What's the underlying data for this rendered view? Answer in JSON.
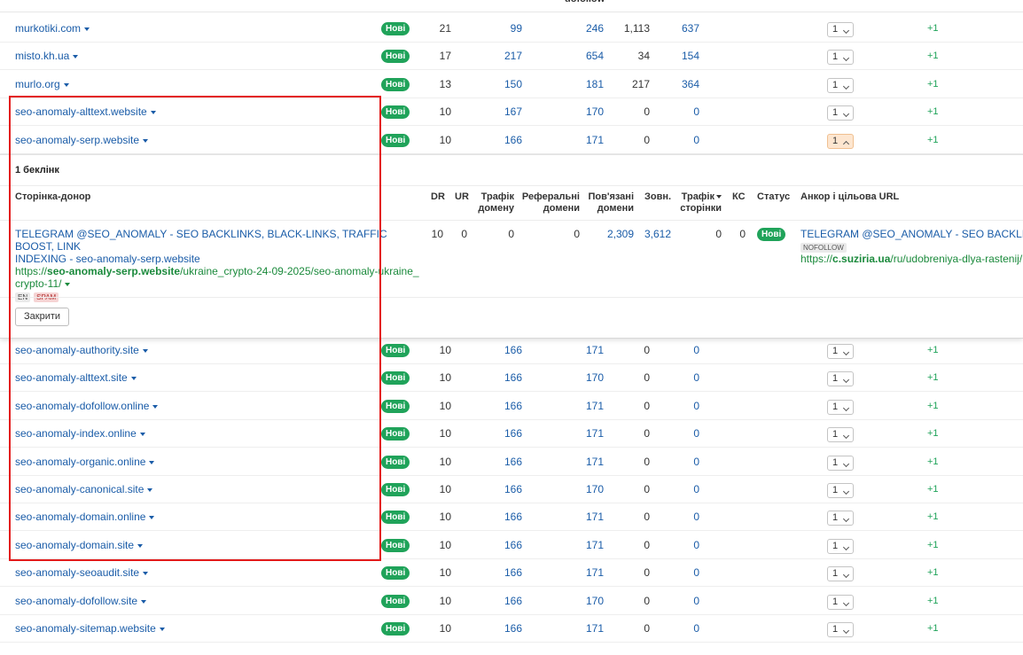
{
  "header_fragment": "dofollow",
  "badge_label": "Нові",
  "rows_top": [
    {
      "domain": "murkotiki.com",
      "dr": "21",
      "a": "99",
      "b": "246",
      "c": "1,113",
      "d": "637",
      "sel": "1",
      "delta": "+1"
    },
    {
      "domain": "misto.kh.ua",
      "dr": "17",
      "a": "217",
      "b": "654",
      "c": "34",
      "d": "154",
      "sel": "1",
      "delta": "+1"
    },
    {
      "domain": "murlo.org",
      "dr": "13",
      "a": "150",
      "b": "181",
      "c": "217",
      "d": "364",
      "sel": "1",
      "delta": "+1"
    },
    {
      "domain": "seo-anomaly-alttext.website",
      "dr": "10",
      "a": "167",
      "b": "170",
      "c": "0",
      "d": "0",
      "sel": "1",
      "delta": "+1"
    },
    {
      "domain": "seo-anomaly-serp.website",
      "dr": "10",
      "a": "166",
      "b": "171",
      "c": "0",
      "d": "0",
      "sel": "1",
      "delta": "+1"
    }
  ],
  "panel": {
    "title": "1 беклінк",
    "headers": {
      "donor": "Сторінка-донор",
      "dr": "DR",
      "ur": "UR",
      "domain_traffic_1": "Трафік",
      "domain_traffic_2": "домену",
      "ref_domains_1": "Реферальні",
      "ref_domains_2": "домени",
      "linked_domains_1": "Пов'язані",
      "linked_domains_2": "домени",
      "external": "Зовн.",
      "page_traffic_1": "Трафік",
      "page_traffic_2": "сторінки",
      "kw": "КС",
      "status": "Статус",
      "anchor": "Анкор і цільова URL"
    },
    "backlink": {
      "title_line1": "TELEGRAM @SEO_ANOMALY - SEO BACKLINKS, BLACK-LINKS, TRAFFIC BOOST, LINK",
      "title_line2": "INDEXING - seo-anomaly-serp.website",
      "url_prefix": "https://",
      "url_domain": "seo-anomaly-serp.website",
      "url_path1": "/ukraine_crypto-24-09-2025/seo-anomaly-ukraine_",
      "url_path2": "crypto-11/",
      "tag_lang": "EN",
      "tag_spam": "SPAM",
      "dr": "10",
      "ur": "0",
      "domain_traffic": "0",
      "ref_domains": "0",
      "linked_domains": "2,309",
      "external": "3,612",
      "page_traffic": "0",
      "kw": "0",
      "status": "Нові",
      "anchor_text": "TELEGRAM @SEO_ANOMALY - SEO BACKLINKS",
      "anchor_tag": "NOFOLLOW",
      "target_prefix": "https://",
      "target_domain": "c.suziria.ua",
      "target_path": "/ru/udobreniya-dlya-rastenij/"
    },
    "close_label": "Закрити"
  },
  "rows_bottom": [
    {
      "domain": "seo-anomaly-authority.site",
      "dr": "10",
      "a": "166",
      "b": "171",
      "c": "0",
      "d": "0",
      "sel": "1",
      "delta": "+1"
    },
    {
      "domain": "seo-anomaly-alttext.site",
      "dr": "10",
      "a": "166",
      "b": "170",
      "c": "0",
      "d": "0",
      "sel": "1",
      "delta": "+1"
    },
    {
      "domain": "seo-anomaly-dofollow.online",
      "dr": "10",
      "a": "166",
      "b": "171",
      "c": "0",
      "d": "0",
      "sel": "1",
      "delta": "+1"
    },
    {
      "domain": "seo-anomaly-index.online",
      "dr": "10",
      "a": "166",
      "b": "171",
      "c": "0",
      "d": "0",
      "sel": "1",
      "delta": "+1"
    },
    {
      "domain": "seo-anomaly-organic.online",
      "dr": "10",
      "a": "166",
      "b": "171",
      "c": "0",
      "d": "0",
      "sel": "1",
      "delta": "+1"
    },
    {
      "domain": "seo-anomaly-canonical.site",
      "dr": "10",
      "a": "166",
      "b": "170",
      "c": "0",
      "d": "0",
      "sel": "1",
      "delta": "+1"
    },
    {
      "domain": "seo-anomaly-domain.online",
      "dr": "10",
      "a": "166",
      "b": "171",
      "c": "0",
      "d": "0",
      "sel": "1",
      "delta": "+1"
    },
    {
      "domain": "seo-anomaly-domain.site",
      "dr": "10",
      "a": "166",
      "b": "171",
      "c": "0",
      "d": "0",
      "sel": "1",
      "delta": "+1"
    },
    {
      "domain": "seo-anomaly-seoaudit.site",
      "dr": "10",
      "a": "166",
      "b": "171",
      "c": "0",
      "d": "0",
      "sel": "1",
      "delta": "+1"
    },
    {
      "domain": "seo-anomaly-dofollow.site",
      "dr": "10",
      "a": "166",
      "b": "170",
      "c": "0",
      "d": "0",
      "sel": "1",
      "delta": "+1"
    },
    {
      "domain": "seo-anomaly-sitemap.website",
      "dr": "10",
      "a": "166",
      "b": "171",
      "c": "0",
      "d": "0",
      "sel": "1",
      "delta": "+1"
    }
  ],
  "colors": {
    "link": "#1a5ca8",
    "badge": "#20a35a",
    "highlight": "#e31a1a",
    "url_green": "#1b8a3c"
  }
}
